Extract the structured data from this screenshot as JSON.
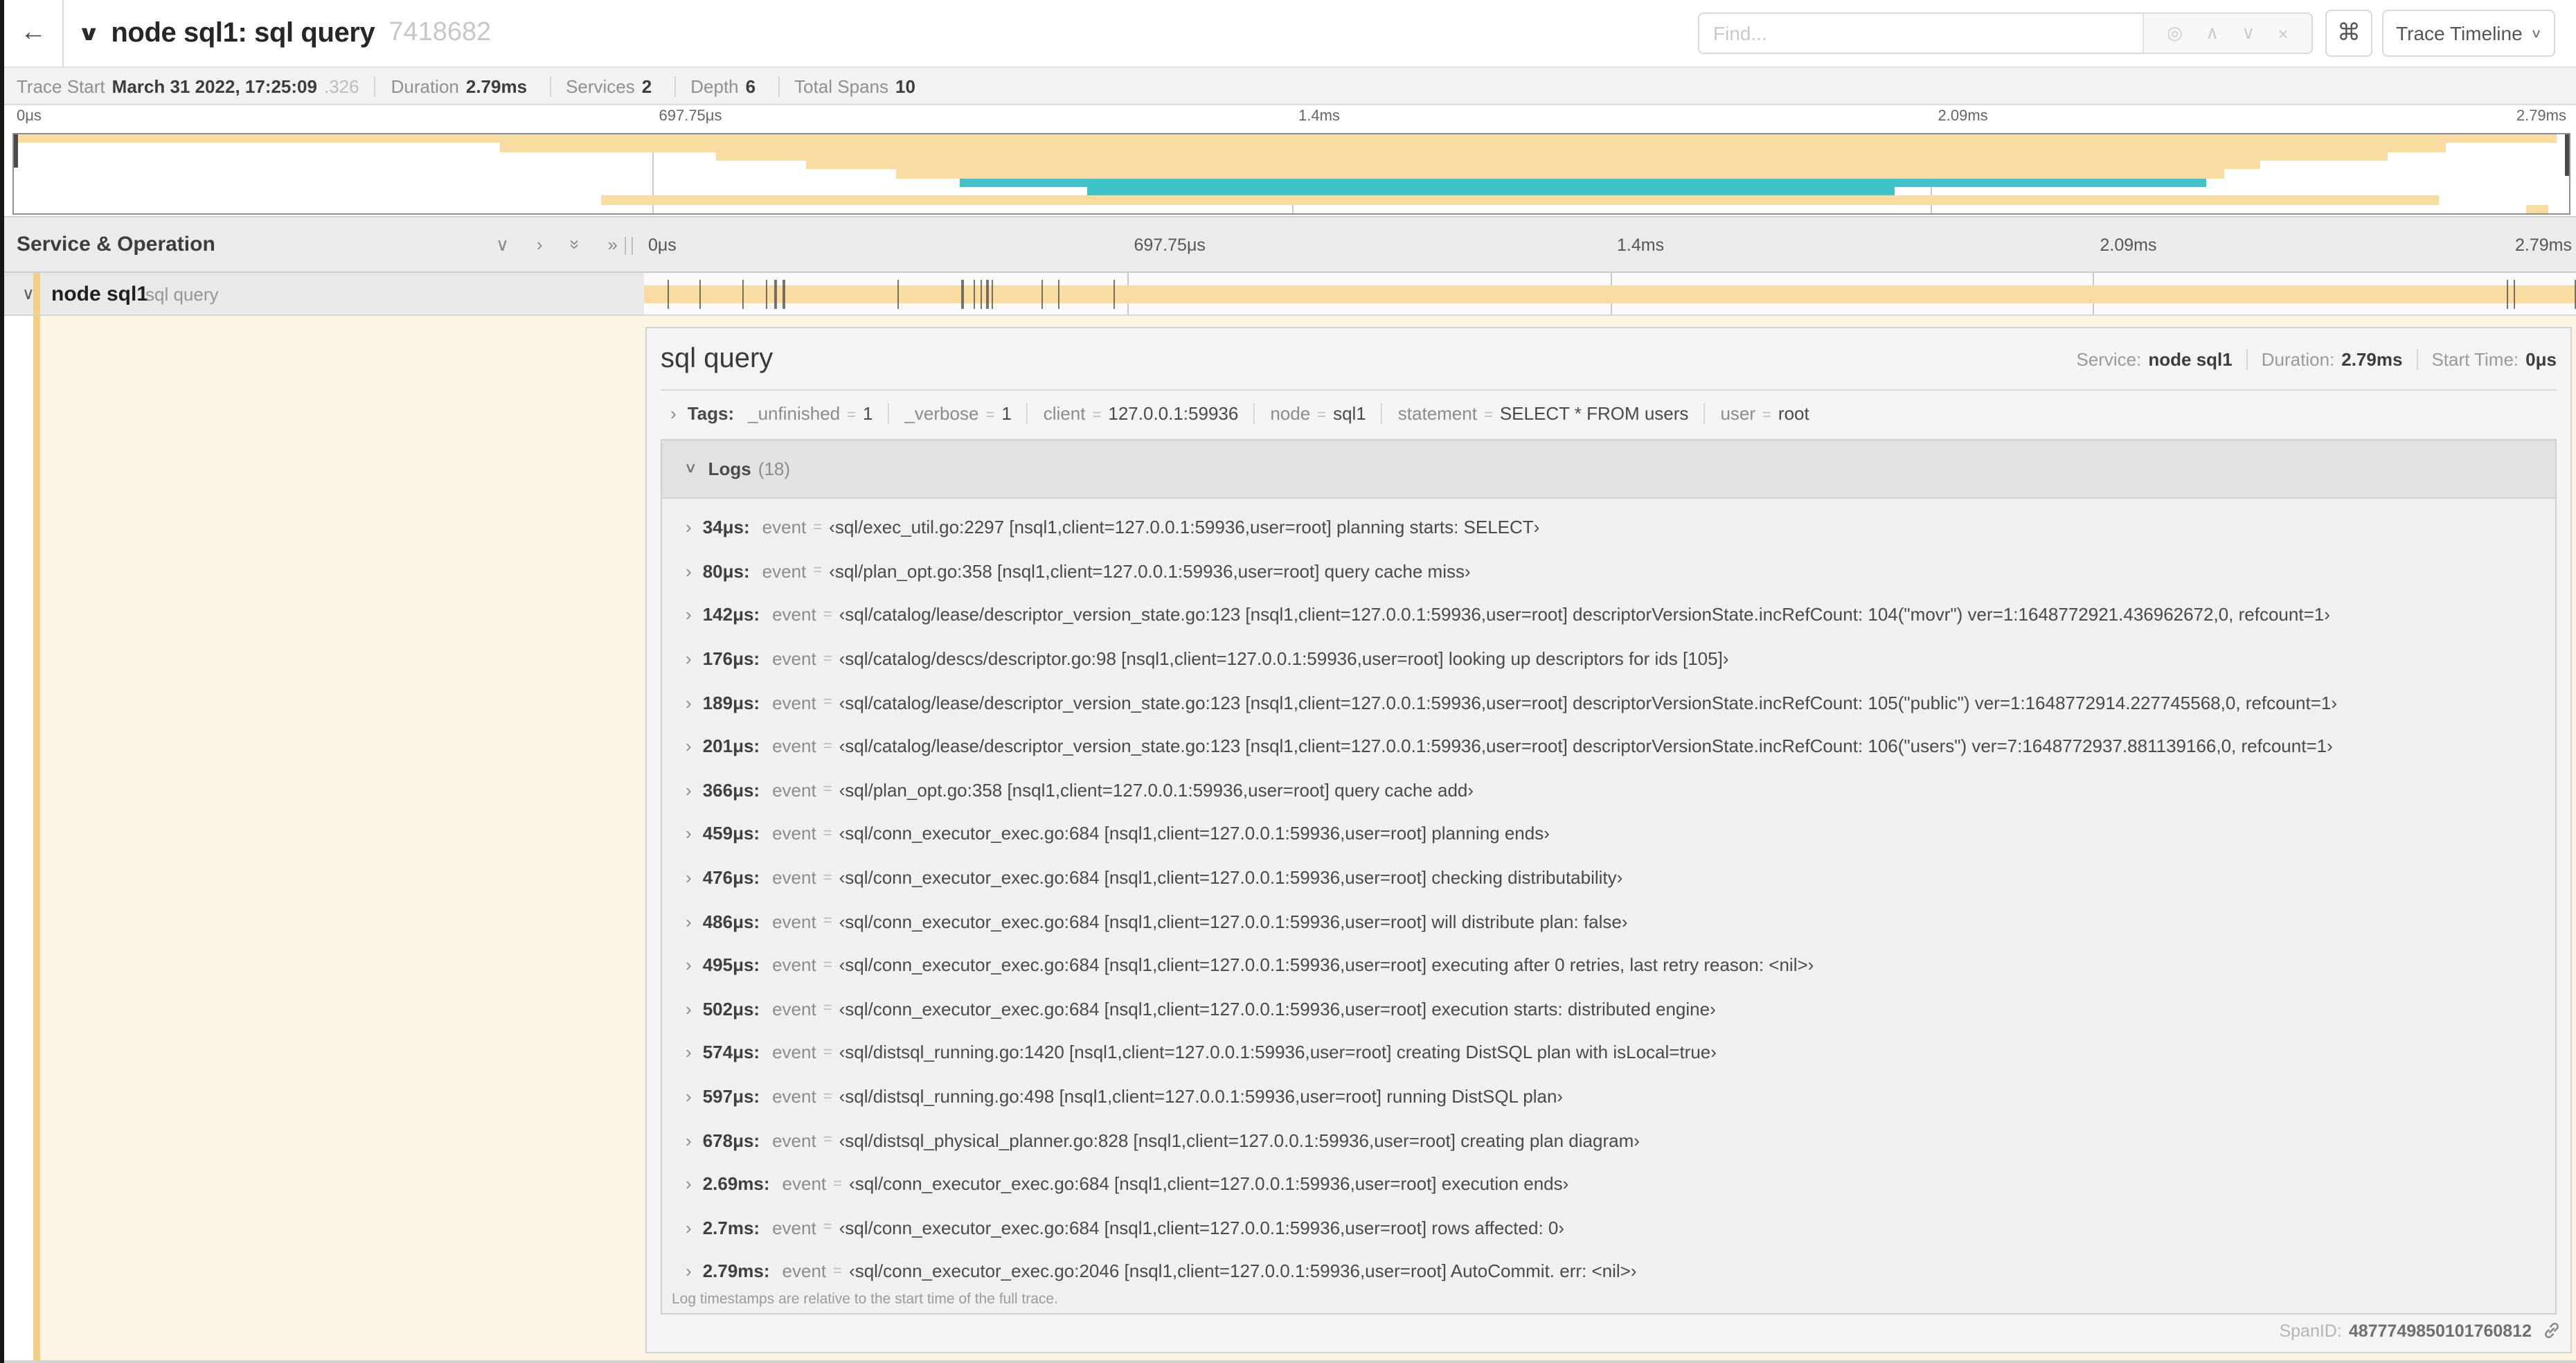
{
  "colors": {
    "orange": "#F8DCA1",
    "orange_strong": "#F3CE85",
    "teal": "#3EC3C9",
    "cream": "#FCF5E4"
  },
  "header": {
    "back_icon": "←",
    "collapse_icon": "∨",
    "title": "node sql1: sql query",
    "trace_id": "7418682",
    "find": {
      "placeholder": "Find...",
      "locate_icon": "◎",
      "prev_icon": "∧",
      "next_icon": "∨",
      "clear_icon": "×"
    },
    "shortcut_icon": "⌘",
    "view_selector": {
      "label": "Trace Timeline",
      "chevron": "∨"
    }
  },
  "trace_info": {
    "items": [
      {
        "label": "Trace Start",
        "value": "March 31 2022, 17:25:09",
        "dim": ".326"
      },
      {
        "label": "Duration",
        "value": "2.79ms",
        "dim": ""
      },
      {
        "label": "Services",
        "value": "2",
        "dim": ""
      },
      {
        "label": "Depth",
        "value": "6",
        "dim": ""
      },
      {
        "label": "Total Spans",
        "value": "10",
        "dim": ""
      }
    ]
  },
  "timeline": {
    "ticks": [
      "0μs",
      "697.75μs",
      "1.4ms",
      "2.09ms",
      "2.79ms"
    ]
  },
  "minimap": {
    "spans": [
      {
        "start": 0.0,
        "end": 0.995,
        "color": "orange"
      },
      {
        "start": 0.19,
        "end": 0.952,
        "color": "orange"
      },
      {
        "start": 0.275,
        "end": 0.929,
        "color": "orange"
      },
      {
        "start": 0.31,
        "end": 0.879,
        "color": "orange"
      },
      {
        "start": 0.345,
        "end": 0.865,
        "color": "orange"
      },
      {
        "start": 0.37,
        "end": 0.858,
        "color": "teal"
      },
      {
        "start": 0.42,
        "end": 0.736,
        "color": "teal"
      },
      {
        "start": 0.23,
        "end": 0.949,
        "color": "orange"
      },
      {
        "start": 0.983,
        "end": 0.992,
        "color": "orange"
      }
    ]
  },
  "span_tree": {
    "header": "Service & Operation",
    "collapse_one_icon": "∨",
    "expand_one_icon": "›",
    "row": {
      "expander_icon": "∨",
      "service": "node sql1",
      "operation": "sql query",
      "bar": {
        "start": 0.0,
        "end": 1.0,
        "color": "orange"
      },
      "log_tick_fractions": [
        0.0122,
        0.0287,
        0.0509,
        0.0631,
        0.0677,
        0.072,
        0.1312,
        0.1645,
        0.1706,
        0.1742,
        0.1774,
        0.1799,
        0.2057,
        0.214,
        0.243,
        0.9642,
        0.9677,
        0.9993
      ]
    }
  },
  "detail": {
    "title": "sql query",
    "summary": [
      {
        "label": "Service:",
        "value": "node sql1"
      },
      {
        "label": "Duration:",
        "value": "2.79ms"
      },
      {
        "label": "Start Time:",
        "value": "0μs"
      }
    ],
    "tags": {
      "label": "Tags:",
      "items": [
        {
          "key": "_unfinished",
          "eq": "=",
          "value": "1"
        },
        {
          "key": "_verbose",
          "eq": "=",
          "value": "1"
        },
        {
          "key": "client",
          "eq": "=",
          "value": "127.0.0.1:59936"
        },
        {
          "key": "node",
          "eq": "=",
          "value": "sql1"
        },
        {
          "key": "statement",
          "eq": "=",
          "value": "SELECT * FROM users"
        },
        {
          "key": "user",
          "eq": "=",
          "value": "root"
        }
      ]
    },
    "logs": {
      "label": "Logs",
      "count": "(18)",
      "entries": [
        {
          "time": "34μs:",
          "key": "event",
          "eq": "=",
          "value": "‹sql/exec_util.go:2297 [nsql1,client=127.0.0.1:59936,user=root] planning starts: SELECT›"
        },
        {
          "time": "80μs:",
          "key": "event",
          "eq": "=",
          "value": "‹sql/plan_opt.go:358 [nsql1,client=127.0.0.1:59936,user=root] query cache miss›"
        },
        {
          "time": "142μs:",
          "key": "event",
          "eq": "=",
          "value": "‹sql/catalog/lease/descriptor_version_state.go:123 [nsql1,client=127.0.0.1:59936,user=root] descriptorVersionState.incRefCount: 104(\"movr\") ver=1:1648772921.436962672,0, refcount=1›"
        },
        {
          "time": "176μs:",
          "key": "event",
          "eq": "=",
          "value": "‹sql/catalog/descs/descriptor.go:98 [nsql1,client=127.0.0.1:59936,user=root] looking up descriptors for ids [105]›"
        },
        {
          "time": "189μs:",
          "key": "event",
          "eq": "=",
          "value": "‹sql/catalog/lease/descriptor_version_state.go:123 [nsql1,client=127.0.0.1:59936,user=root] descriptorVersionState.incRefCount: 105(\"public\") ver=1:1648772914.227745568,0, refcount=1›"
        },
        {
          "time": "201μs:",
          "key": "event",
          "eq": "=",
          "value": "‹sql/catalog/lease/descriptor_version_state.go:123 [nsql1,client=127.0.0.1:59936,user=root] descriptorVersionState.incRefCount: 106(\"users\") ver=7:1648772937.881139166,0, refcount=1›"
        },
        {
          "time": "366μs:",
          "key": "event",
          "eq": "=",
          "value": "‹sql/plan_opt.go:358 [nsql1,client=127.0.0.1:59936,user=root] query cache add›"
        },
        {
          "time": "459μs:",
          "key": "event",
          "eq": "=",
          "value": "‹sql/conn_executor_exec.go:684 [nsql1,client=127.0.0.1:59936,user=root] planning ends›"
        },
        {
          "time": "476μs:",
          "key": "event",
          "eq": "=",
          "value": "‹sql/conn_executor_exec.go:684 [nsql1,client=127.0.0.1:59936,user=root] checking distributability›"
        },
        {
          "time": "486μs:",
          "key": "event",
          "eq": "=",
          "value": "‹sql/conn_executor_exec.go:684 [nsql1,client=127.0.0.1:59936,user=root] will distribute plan: false›"
        },
        {
          "time": "495μs:",
          "key": "event",
          "eq": "=",
          "value": "‹sql/conn_executor_exec.go:684 [nsql1,client=127.0.0.1:59936,user=root] executing after 0 retries, last retry reason: <nil>›"
        },
        {
          "time": "502μs:",
          "key": "event",
          "eq": "=",
          "value": "‹sql/conn_executor_exec.go:684 [nsql1,client=127.0.0.1:59936,user=root] execution starts: distributed engine›"
        },
        {
          "time": "574μs:",
          "key": "event",
          "eq": "=",
          "value": "‹sql/distsql_running.go:1420 [nsql1,client=127.0.0.1:59936,user=root] creating DistSQL plan with isLocal=true›"
        },
        {
          "time": "597μs:",
          "key": "event",
          "eq": "=",
          "value": "‹sql/distsql_running.go:498 [nsql1,client=127.0.0.1:59936,user=root] running DistSQL plan›"
        },
        {
          "time": "678μs:",
          "key": "event",
          "eq": "=",
          "value": "‹sql/distsql_physical_planner.go:828 [nsql1,client=127.0.0.1:59936,user=root] creating plan diagram›"
        },
        {
          "time": "2.69ms:",
          "key": "event",
          "eq": "=",
          "value": "‹sql/conn_executor_exec.go:684 [nsql1,client=127.0.0.1:59936,user=root] execution ends›"
        },
        {
          "time": "2.7ms:",
          "key": "event",
          "eq": "=",
          "value": "‹sql/conn_executor_exec.go:684 [nsql1,client=127.0.0.1:59936,user=root] rows affected: 0›"
        },
        {
          "time": "2.79ms:",
          "key": "event",
          "eq": "=",
          "value": "‹sql/conn_executor_exec.go:2046 [nsql1,client=127.0.0.1:59936,user=root] AutoCommit. err: <nil>›"
        }
      ],
      "footnote": "Log timestamps are relative to the start time of the full trace."
    },
    "span_id_label": "SpanID:",
    "span_id": "4877749850101760812"
  }
}
